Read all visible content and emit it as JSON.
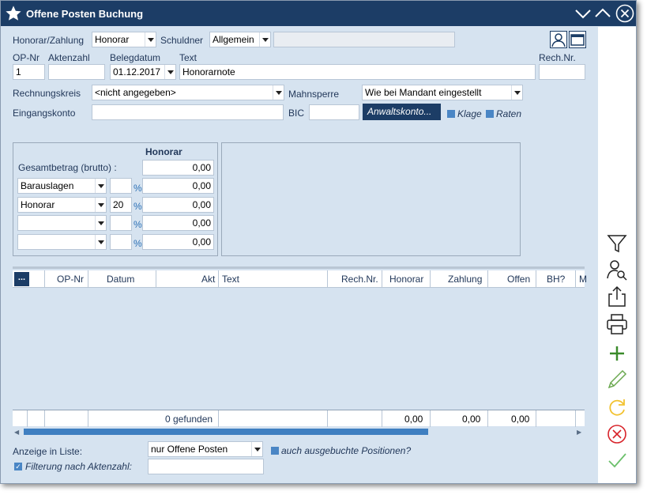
{
  "window": {
    "title": "Offene Posten Buchung"
  },
  "form": {
    "honorar_zahlung_label": "Honorar/Zahlung",
    "honorar_zahlung_value": "Honorar",
    "schuldner_label": "Schuldner",
    "schuldner_value": "Allgemein",
    "op_nr_label": "OP-Nr",
    "op_nr_value": "1",
    "aktenzahl_label": "Aktenzahl",
    "aktenzahl_value": "",
    "belegdatum_label": "Belegdatum",
    "belegdatum_value": "01.12.2017",
    "text_label": "Text",
    "text_value": "Honorarnote",
    "rech_nr_label": "Rech.Nr.",
    "rech_nr_value": "",
    "rechnungskreis_label": "Rechnungskreis",
    "rechnungskreis_value": "<nicht angegeben>",
    "mahnsperre_label": "Mahnsperre",
    "mahnsperre_value": "Wie bei Mandant eingestellt",
    "eingangskonto_label": "Eingangskonto",
    "eingangskonto_value": "",
    "bic_label": "BIC",
    "bic_value": "",
    "anwaltskonto_button": "Anwaltskonto...",
    "klage_label": "Klage",
    "raten_label": "Raten"
  },
  "honorar_panel": {
    "header": "Honorar",
    "gesamt_label": "Gesamtbetrag (brutto) :",
    "gesamt_value": "0,00",
    "rows": [
      {
        "type": "Barauslagen",
        "pct": "",
        "amount": "0,00"
      },
      {
        "type": "Honorar",
        "pct": "20",
        "amount": "0,00"
      },
      {
        "type": "",
        "pct": "",
        "amount": "0,00"
      },
      {
        "type": "",
        "pct": "",
        "amount": "0,00"
      }
    ],
    "pct_symbol": "%"
  },
  "table": {
    "columns": [
      "...",
      "OP-Nr",
      "Datum",
      "Akt",
      "Text",
      "Rech.Nr.",
      "Honorar",
      "Zahlung",
      "Offen",
      "BH?",
      "M"
    ],
    "footer": {
      "count": "0 gefunden",
      "honorar": "0,00",
      "zahlung": "0,00",
      "offen": "0,00"
    }
  },
  "bottom": {
    "anzeige_label": "Anzeige in Liste:",
    "anzeige_value": "nur Offene Posten",
    "ausgebucht_label": "auch ausgebuchte Positionen?",
    "filter_label": "Filterung nach Aktenzahl:",
    "filter_value": ""
  },
  "sidebar": {
    "icons": [
      "filter-icon",
      "person-search-icon",
      "export-icon",
      "print-icon",
      "add-icon",
      "edit-icon",
      "refresh-icon",
      "cancel-icon",
      "confirm-icon"
    ]
  },
  "colors": {
    "titlebar": "#1c3d66",
    "background": "#d6e3f0",
    "accent": "#4a86c5",
    "button": "#1c3d66",
    "add": "#3a8a2a",
    "cancel": "#d8232a",
    "refresh": "#f2c230",
    "confirm": "#6cc06c"
  }
}
